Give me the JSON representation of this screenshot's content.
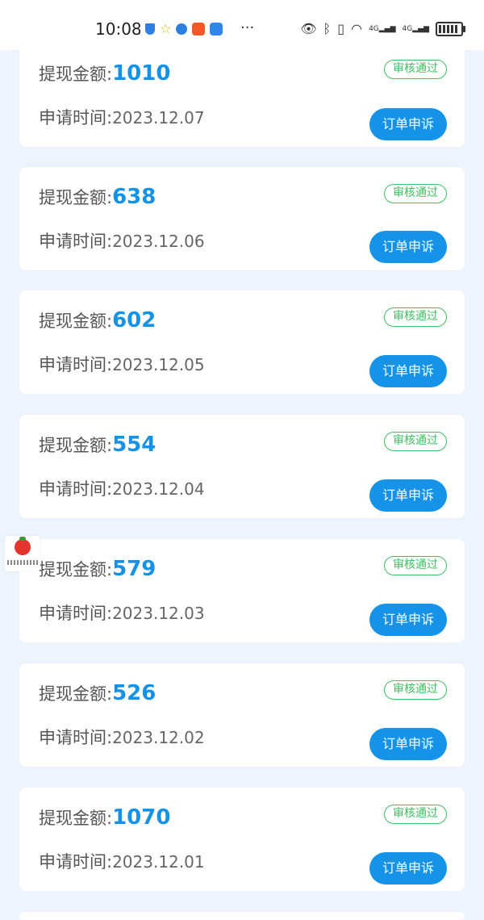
{
  "status_bar": {
    "time": "10:08",
    "dots": "···",
    "signal_1": "4G",
    "signal_2": "4G"
  },
  "icons": {
    "shield": "shield-icon",
    "star": "star-icon",
    "globe": "globe-icon",
    "app": "app-icon",
    "cloud": "cloud-icon",
    "eye": "eye-icon",
    "bluetooth": "bluetooth-icon",
    "vibrate": "vibrate-icon",
    "wifi": "wifi-icon",
    "battery": "battery-icon"
  },
  "colors": {
    "accent": "#1593e9",
    "amount": "#1592e6",
    "approved": "#3fbf62",
    "background": "#eef4fb"
  },
  "records": [
    {
      "amount_label": "提现金额:",
      "amount": "1010",
      "time_label": "申请时间:",
      "date": "2023.12.07",
      "status": "审核通过",
      "action": "订单申诉"
    },
    {
      "amount_label": "提现金额:",
      "amount": "638",
      "time_label": "申请时间:",
      "date": "2023.12.06",
      "status": "审核通过",
      "action": "订单申诉"
    },
    {
      "amount_label": "提现金额:",
      "amount": "602",
      "time_label": "申请时间:",
      "date": "2023.12.05",
      "status": "审核通过",
      "action": "订单申诉"
    },
    {
      "amount_label": "提现金额:",
      "amount": "554",
      "time_label": "申请时间:",
      "date": "2023.12.04",
      "status": "审核通过",
      "action": "订单申诉"
    },
    {
      "amount_label": "提现金额:",
      "amount": "579",
      "time_label": "申请时间:",
      "date": "2023.12.03",
      "status": "审核通过",
      "action": "订单申诉"
    },
    {
      "amount_label": "提现金额:",
      "amount": "526",
      "time_label": "申请时间:",
      "date": "2023.12.02",
      "status": "审核通过",
      "action": "订单申诉"
    },
    {
      "amount_label": "提现金额:",
      "amount": "1070",
      "time_label": "申请时间:",
      "date": "2023.12.01",
      "status": "审核通过",
      "action": "订单申诉"
    }
  ]
}
